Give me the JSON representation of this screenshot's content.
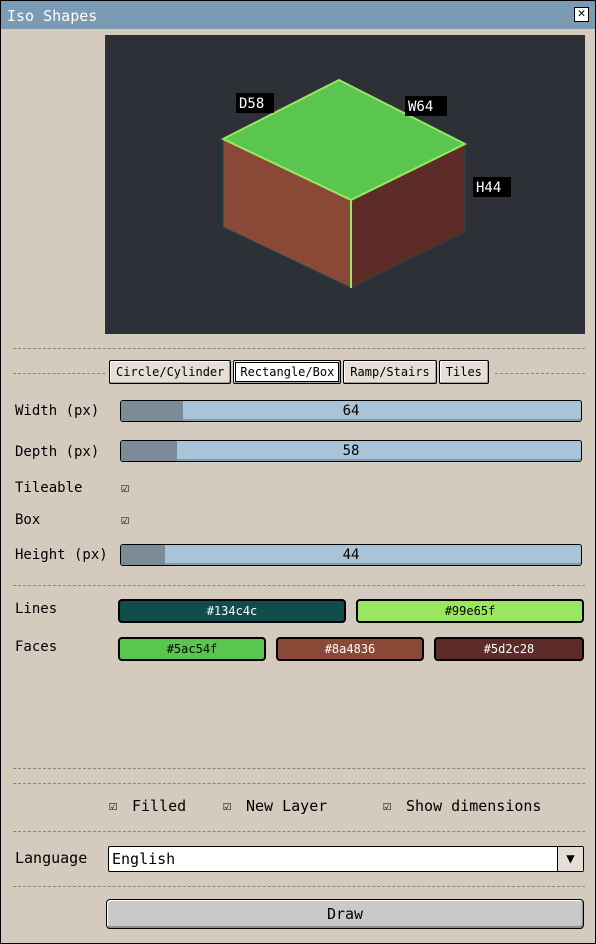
{
  "window": {
    "title": "Iso Shapes",
    "close_glyph": "✕"
  },
  "preview": {
    "labels": {
      "depth": "D58",
      "width": "W64",
      "height": "H44"
    }
  },
  "tabs": [
    {
      "label": "Circle/Cylinder",
      "active": false
    },
    {
      "label": "Rectangle/Box",
      "active": true
    },
    {
      "label": "Ramp/Stairs",
      "active": false
    },
    {
      "label": "Tiles",
      "active": false
    }
  ],
  "fields": {
    "width": {
      "label": "Width (px)",
      "value": "64",
      "fill_fraction": 0.13
    },
    "depth": {
      "label": "Depth (px)",
      "value": "58",
      "fill_fraction": 0.12
    },
    "tileable": {
      "label": "Tileable",
      "checked": true
    },
    "box": {
      "label": "Box",
      "checked": true
    },
    "height": {
      "label": "Height (px)",
      "value": "44",
      "fill_fraction": 0.1
    }
  },
  "colors": {
    "lines_label": "Lines",
    "faces_label": "Faces",
    "lines": [
      {
        "hex": "#134c4c",
        "text": "#134c4c"
      },
      {
        "hex": "#99e65f",
        "text": "#99e65f"
      }
    ],
    "faces": [
      {
        "hex": "#5ac54f",
        "text": "#5ac54f"
      },
      {
        "hex": "#8a4836",
        "text": "#8a4836"
      },
      {
        "hex": "#5d2c28",
        "text": "#5d2c28"
      }
    ]
  },
  "options": {
    "filled": {
      "label": "Filled",
      "checked": true
    },
    "new_layer": {
      "label": "New Layer",
      "checked": true
    },
    "show_dimensions": {
      "label": "Show dimensions",
      "checked": true
    }
  },
  "language": {
    "label": "Language",
    "value": "English",
    "arrow_glyph": "▼"
  },
  "draw": {
    "label": "Draw"
  },
  "check_glyph": "☑"
}
